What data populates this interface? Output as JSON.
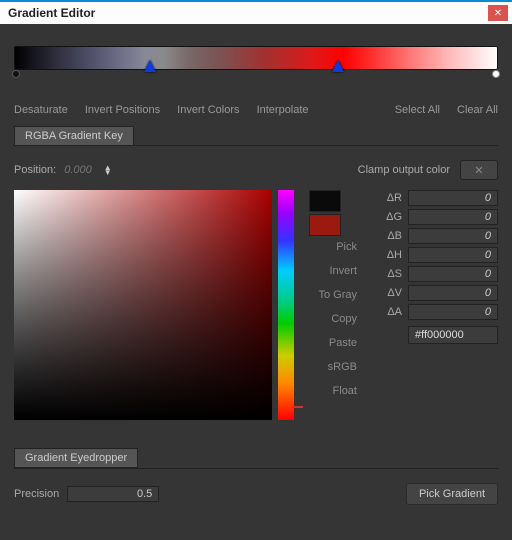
{
  "window": {
    "title": "Gradient Editor"
  },
  "toolbar": {
    "left": [
      "Desaturate",
      "Invert Positions",
      "Invert Colors",
      "Interpolate"
    ],
    "right": [
      "Select All",
      "Clear All"
    ]
  },
  "tabs": {
    "rgba": "RGBA Gradient Key"
  },
  "position": {
    "label": "Position:",
    "value": "0.000"
  },
  "clamp": {
    "label": "Clamp output color",
    "icon": "✕"
  },
  "deltas": {
    "dR": {
      "label": "ΔR",
      "value": "0"
    },
    "dG": {
      "label": "ΔG",
      "value": "0"
    },
    "dB": {
      "label": "ΔB",
      "value": "0"
    },
    "dH": {
      "label": "ΔH",
      "value": "0"
    },
    "dS": {
      "label": "ΔS",
      "value": "0"
    },
    "dV": {
      "label": "ΔV",
      "value": "0"
    },
    "dA": {
      "label": "ΔA",
      "value": "0"
    }
  },
  "actions": {
    "pick": "Pick",
    "invert": "Invert",
    "togray": "To Gray",
    "copy": "Copy",
    "paste": "Paste",
    "srgb": "sRGB",
    "float": "Float"
  },
  "hex": {
    "value": "#ff000000"
  },
  "eyedropper": {
    "tab": "Gradient Eyedropper",
    "precision_label": "Precision",
    "precision_value": "0.5",
    "pick_button": "Pick Gradient"
  }
}
